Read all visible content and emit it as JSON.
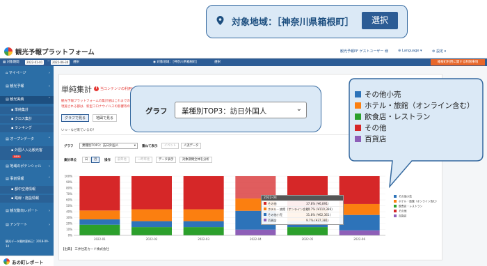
{
  "app": {
    "title": "観光予報プラットフォーム",
    "user": "観光予報PF ゲストユーザー 様",
    "language": "Language",
    "settings": "設定"
  },
  "filterbar": {
    "label": "対象期間",
    "date_from": "2022-01-01",
    "date_to": "2022-06-30",
    "select": "選択",
    "area_label": "対象地域：［神奈川県箱根町］",
    "area_select": "選択",
    "guide": "箱根町利用に関する制限事項"
  },
  "sidebar": {
    "items": [
      {
        "label": "マイページ"
      },
      {
        "label": "観光予報"
      },
      {
        "label": "観光実績"
      },
      {
        "label": "単純集計"
      },
      {
        "label": "クロス集計"
      },
      {
        "label": "ランキング"
      },
      {
        "label": "オープンデータ"
      },
      {
        "label": "外国人入込観光客",
        "badge": "NEW"
      },
      {
        "label": "地域のポテンシャル"
      },
      {
        "label": "事前情報"
      },
      {
        "label": "都中空港情報"
      },
      {
        "label": "路線・施設情報"
      },
      {
        "label": "観光動向レポート"
      },
      {
        "label": "アンケート"
      }
    ],
    "footer": "観光データ最終更新日：2018-09-14",
    "footer_button": "あの町レポート"
  },
  "main": {
    "title": "単純集計",
    "warning": "当コンテンツの利用について",
    "desc_lines": [
      "観光予報プラットフォームの集計値はこれまでの観光動向をもとに",
      "現施される都は、新型コロナウイルスの影響等の外"
    ],
    "view_graph": "グラフで見る",
    "view_map": "地図で見る",
    "question": "いつ・なぜ来ているの？",
    "graph_label": "グラフ",
    "graph_select": "業種別TOP3：訪日外国人",
    "show_label": "重ねて表示",
    "event_btn": "イベント",
    "people_btn": "人流データ",
    "unit_label": "集計単位",
    "unit_day": "日",
    "unit_month": "月",
    "op_label": "操作",
    "op_prev": "前年比",
    "op_year": "一昨年比",
    "op_data": "データ表示",
    "op_all": "対象期間全体を分析",
    "source": "【出典】 三井住友カード株式会社"
  },
  "chart_data": {
    "type": "bar",
    "stacked": true,
    "percent": true,
    "categories": [
      "2022-01",
      "2022-02",
      "2022-03",
      "2022-04",
      "2022-05",
      "2022-06"
    ],
    "ylim": [
      0,
      100
    ],
    "yticks": [
      "100%",
      "90%",
      "80%",
      "70%",
      "60%",
      "50%",
      "40%",
      "30%",
      "20%",
      "10%",
      "0%"
    ],
    "series": [
      {
        "name": "百貨店",
        "color": "#8e5fb8",
        "values": [
          0,
          0,
          0,
          9.7,
          0,
          8.5
        ]
      },
      {
        "name": "飲食店・レストラン",
        "color": "#2ca02c",
        "values": [
          18,
          14,
          14,
          0,
          14,
          0
        ]
      },
      {
        "name": "その他小売",
        "color": "#2d73b9",
        "values": [
          9,
          10,
          10,
          31.8,
          10,
          26
        ]
      },
      {
        "name": "ホテル・旅館（オンライン含む）",
        "color": "#fb7f10",
        "values": [
          15,
          20,
          20,
          20.7,
          21,
          18.5
        ]
      },
      {
        "name": "その他",
        "color": "#d62728",
        "values": [
          58,
          56,
          56,
          37.8,
          55,
          47
        ]
      }
    ],
    "tooltip": {
      "title": "2022-04",
      "rows": [
        {
          "name": "その他",
          "value": "37.8% (¥6,891)"
        },
        {
          "name": "ホテル・旅館（オンライン含む）",
          "value": "20.7% (¥110,386)"
        },
        {
          "name": "その他小売",
          "value": "31.8% (¥62,361)"
        },
        {
          "name": "百貨店",
          "value": "9.7% (¥37,381)"
        }
      ]
    },
    "legend_position": "right"
  },
  "callout_area": {
    "label": "対象地域：［神奈川県箱根町］",
    "button": "選択"
  },
  "callout_graph": {
    "label": "グラフ",
    "select": "業種別TOP3：訪日外国人"
  },
  "callout_legend": {
    "items": [
      {
        "name": "その他小売",
        "color": "#2d73b9"
      },
      {
        "name": "ホテル・旅館（オンライン含む）",
        "color": "#fb7f10"
      },
      {
        "name": "飲食店・レストラン",
        "color": "#2ca02c"
      },
      {
        "name": "その他",
        "color": "#d62728"
      },
      {
        "name": "百貨店",
        "color": "#8e5fb8"
      }
    ]
  }
}
